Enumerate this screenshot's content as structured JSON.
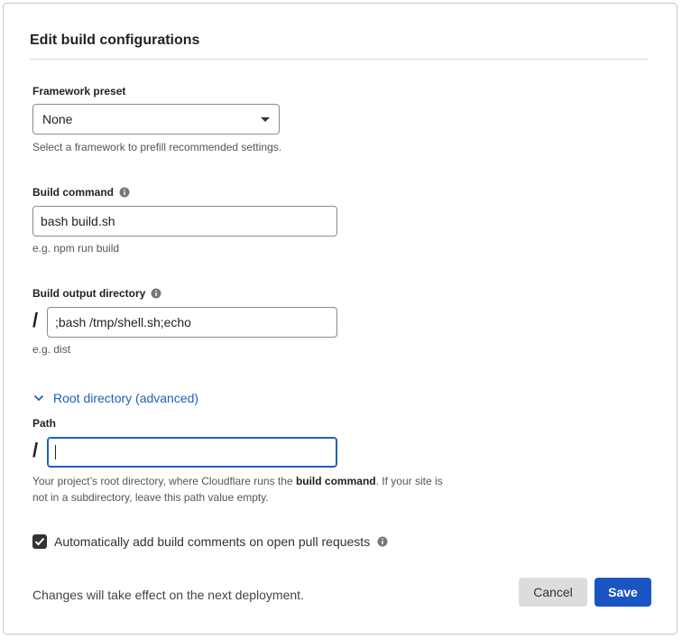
{
  "dialog": {
    "title": "Edit build configurations"
  },
  "framework": {
    "label": "Framework preset",
    "selected": "None",
    "help": "Select a framework to prefill recommended settings."
  },
  "build_command": {
    "label": "Build command",
    "value": "bash build.sh",
    "help": "e.g. npm run build"
  },
  "output_dir": {
    "label": "Build output directory",
    "prefix": "/",
    "value": ";bash /tmp/shell.sh;echo",
    "help": "e.g. dist"
  },
  "root_dir": {
    "toggle_label": "Root directory (advanced)",
    "path_label": "Path",
    "prefix": "/",
    "value": "",
    "help_before": "Your project’s root directory, where Cloudflare runs the ",
    "help_bold": "build command",
    "help_after": ". If your site is not in a subdirectory, leave this path value empty."
  },
  "comments": {
    "checked": true,
    "label": "Automatically add build comments on open pull requests"
  },
  "footer": {
    "note": "Changes will take effect on the next deployment.",
    "cancel_label": "Cancel",
    "save_label": "Save"
  },
  "colors": {
    "accent": "#1a55c4",
    "link": "#1f5fbf"
  },
  "icons": [
    "info-icon",
    "chevron-down-icon",
    "check-icon",
    "caret-down-icon"
  ]
}
